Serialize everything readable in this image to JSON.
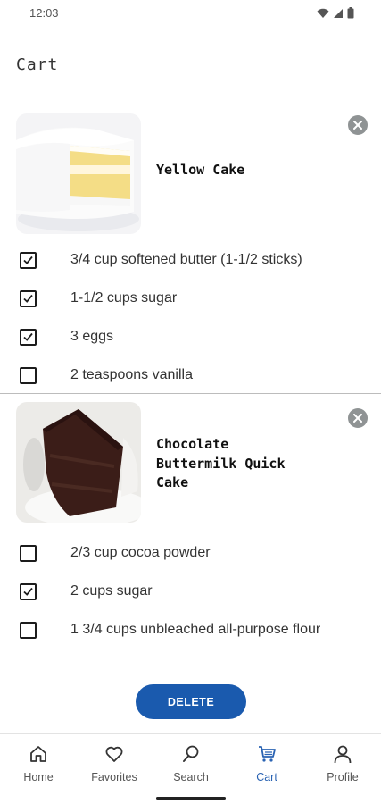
{
  "status_bar": {
    "time": "12:03"
  },
  "page": {
    "title": "Cart"
  },
  "cart_items": [
    {
      "title": "Yellow Cake",
      "ingredients": [
        {
          "label": "3/4 cup softened butter (1-1/2 sticks)",
          "checked": true
        },
        {
          "label": "1-1/2 cups sugar",
          "checked": true
        },
        {
          "label": "3 eggs",
          "checked": true
        },
        {
          "label": "2 teaspoons vanilla",
          "checked": false
        }
      ]
    },
    {
      "title": "Chocolate\nButtermilk Quick\nCake",
      "ingredients": [
        {
          "label": "2/3 cup cocoa powder",
          "checked": false
        },
        {
          "label": "2 cups sugar",
          "checked": true
        },
        {
          "label": "1 3/4 cups unbleached all-purpose flour",
          "checked": false
        }
      ]
    }
  ],
  "actions": {
    "delete_label": "DELETE"
  },
  "bottom_nav": {
    "items": [
      {
        "label": "Home",
        "icon": "home-icon",
        "active": false
      },
      {
        "label": "Favorites",
        "icon": "heart-icon",
        "active": false
      },
      {
        "label": "Search",
        "icon": "search-icon",
        "active": false
      },
      {
        "label": "Cart",
        "icon": "cart-icon",
        "active": true
      },
      {
        "label": "Profile",
        "icon": "person-icon",
        "active": false
      }
    ]
  },
  "colors": {
    "accent": "#1a5aae",
    "active_nav": "#2a63b3",
    "remove_button": "#8f9394"
  }
}
